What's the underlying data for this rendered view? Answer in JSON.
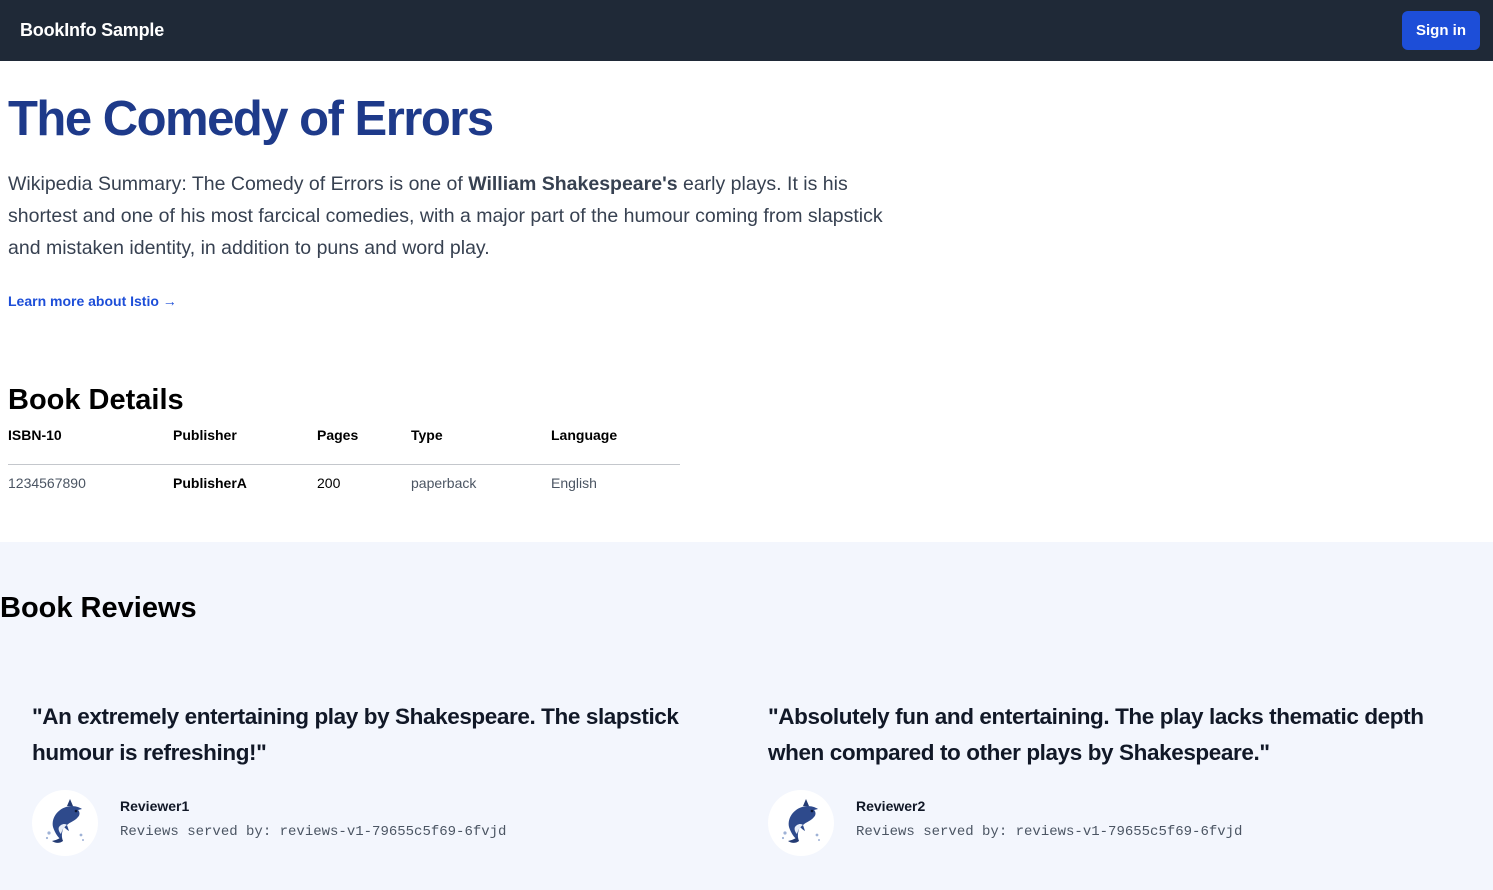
{
  "navbar": {
    "brand": "BookInfo Sample",
    "signin_label": "Sign in"
  },
  "book": {
    "title": "The Comedy of Errors",
    "summary_prefix": "Wikipedia Summary: The Comedy of Errors is one of ",
    "summary_author": "William Shakespeare's",
    "summary_suffix": " early plays. It is his shortest and one of his most farcical comedies, with a major part of the humour coming from slapstick and mistaken identity, in addition to puns and word play.",
    "learn_more": "Learn more about Istio →"
  },
  "details": {
    "heading": "Book Details",
    "columns": [
      "ISBN-10",
      "Publisher",
      "Pages",
      "Type",
      "Language"
    ],
    "row": [
      "1234567890",
      "PublisherA",
      "200",
      "paperback",
      "English"
    ]
  },
  "reviews": {
    "heading": "Book Reviews",
    "items": [
      {
        "text": "\"An extremely entertaining play by Shakespeare. The slapstick humour is refreshing!\"",
        "reviewer": "Reviewer1",
        "served_by": "Reviews served by: reviews-v1-79655c5f69-6fvjd",
        "avatar_icon": "dolphin-icon"
      },
      {
        "text": "\"Absolutely fun and entertaining. The play lacks thematic depth when compared to other plays by Shakespeare.\"",
        "reviewer": "Reviewer2",
        "served_by": "Reviews served by: reviews-v1-79655c5f69-6fvjd",
        "avatar_icon": "dolphin-icon"
      }
    ]
  },
  "colors": {
    "navbar_bg": "#1f2937",
    "accent": "#1d4ed8",
    "title": "#1e3a8a",
    "reviews_bg": "#f3f6fd"
  }
}
